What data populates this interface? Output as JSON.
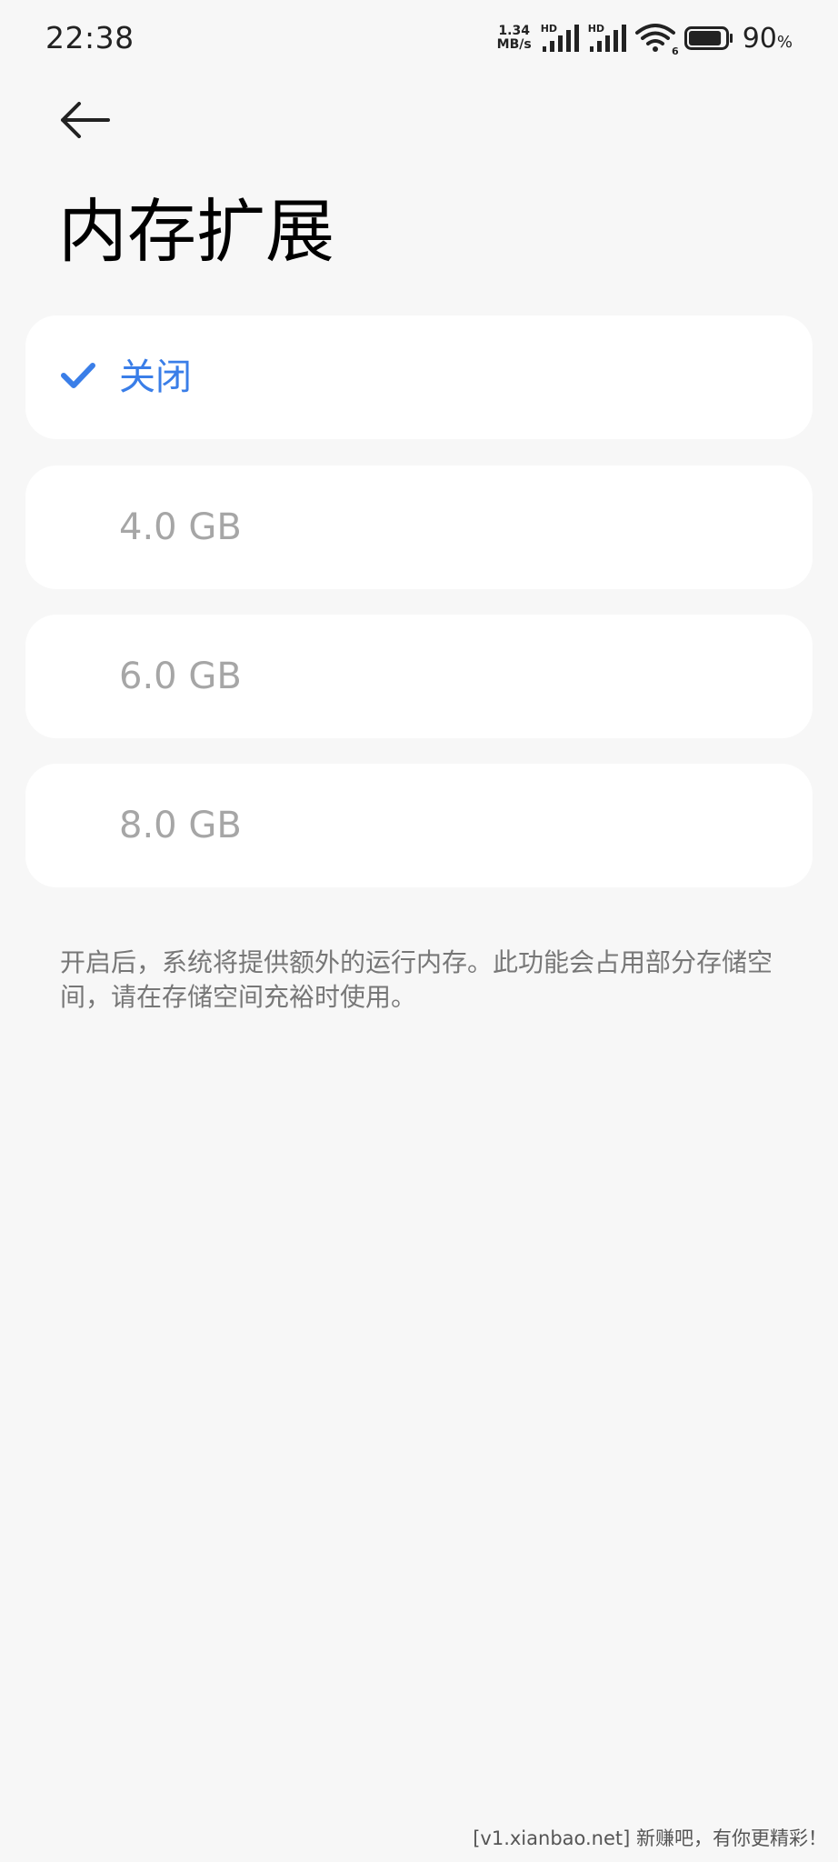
{
  "status_bar": {
    "time": "22:38",
    "net_speed_value": "1.34",
    "net_speed_unit": "MB/s",
    "sim1_label": "HD",
    "sim2_label": "HD",
    "wifi_sub": "6",
    "battery_percent": "90",
    "battery_unit": "%",
    "battery_level": 0.9
  },
  "header": {
    "back_icon": "arrow-left-icon",
    "title": "内存扩展"
  },
  "options": [
    {
      "label": "关闭",
      "selected": true
    },
    {
      "label": "4.0 GB",
      "selected": false
    },
    {
      "label": "6.0 GB",
      "selected": false
    },
    {
      "label": "8.0 GB",
      "selected": false
    }
  ],
  "description": "开启后，系统将提供额外的运行内存。此功能会占用部分存储空间，请在存储空间充裕时使用。",
  "watermark": "[v1.xianbao.net] 新赚吧，有你更精彩！",
  "colors": {
    "accent": "#3a7ee8",
    "background": "#f7f7f7",
    "card": "#ffffff",
    "muted_text": "#a6a6a6"
  }
}
